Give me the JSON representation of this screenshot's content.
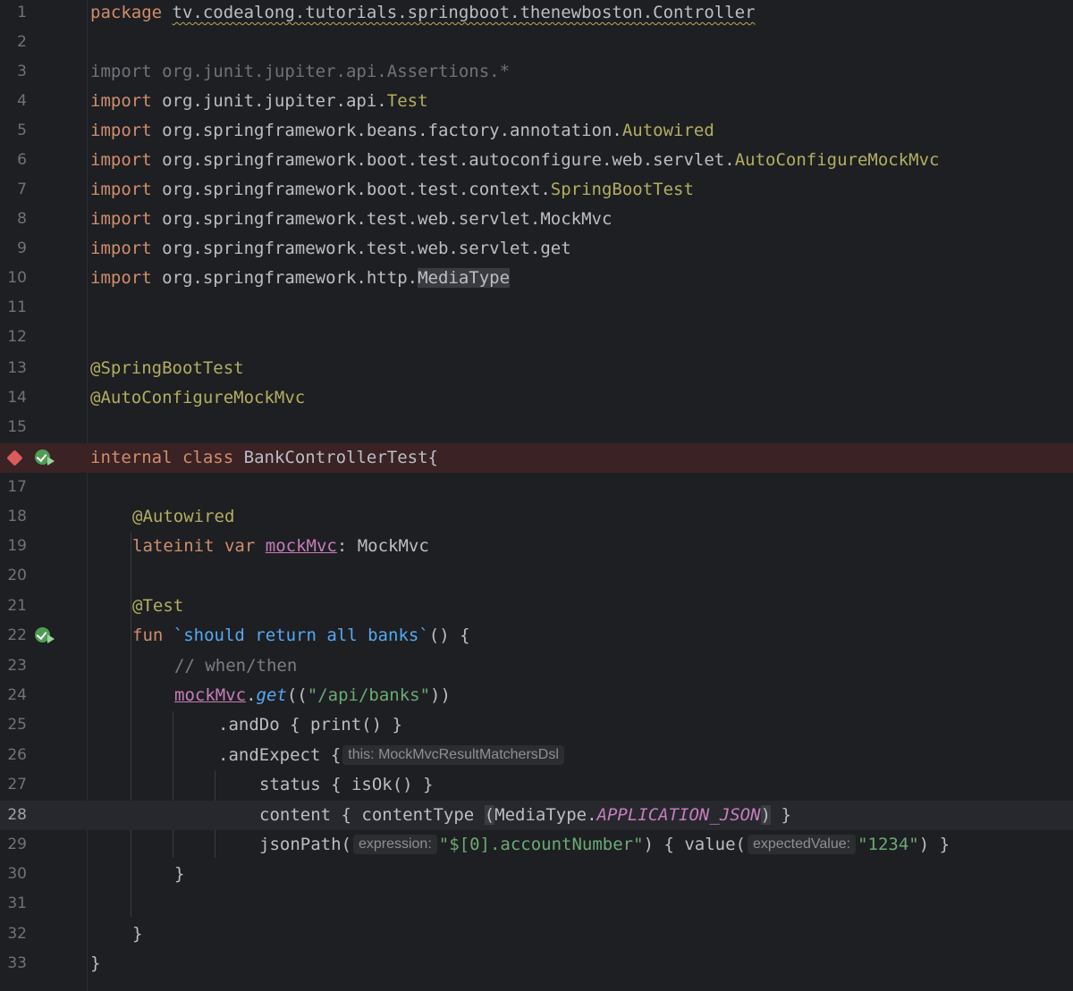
{
  "editor": {
    "language": "Kotlin",
    "caret_line": 28,
    "breakpoint_line": 16,
    "run_gutter_lines": [
      16,
      22
    ],
    "colors": {
      "background": "#1e1f22",
      "keyword": "#cf8e6d",
      "annotation": "#b3ae60",
      "string": "#6aab73",
      "function": "#56a8f5",
      "property": "#c77dbb",
      "breakpoint": "#db5c5c",
      "run_icon": "#4f9d54"
    },
    "line_numbers": [
      "1",
      "2",
      "3",
      "4",
      "5",
      "6",
      "7",
      "8",
      "9",
      "10",
      "11",
      "12",
      "13",
      "14",
      "15",
      "",
      "17",
      "18",
      "19",
      "20",
      "21",
      "22",
      "23",
      "24",
      "25",
      "26",
      "27",
      "28",
      "29",
      "30",
      "31",
      "32",
      "33"
    ],
    "tokens": {
      "package_kw": "package",
      "package_name": "tv.codealong.tutorials.springboot.thenewboston.Controller",
      "import_kw": "import",
      "imp3_path": "org.junit.jupiter.api.Assertions.*",
      "imp4_path": "org.junit.jupiter.api.",
      "imp4_cls": "Test",
      "imp5_path": "org.springframework.beans.factory.annotation.",
      "imp5_cls": "Autowired",
      "imp6_path": "org.springframework.boot.test.autoconfigure.web.servlet.",
      "imp6_cls": "AutoConfigureMockMvc",
      "imp7_path": "org.springframework.boot.test.context.",
      "imp7_cls": "SpringBootTest",
      "imp8_path": "org.springframework.test.web.servlet.MockMvc",
      "imp9_path": "org.springframework.test.web.servlet.get",
      "imp10_path": "org.springframework.http.",
      "imp10_cls": "MediaType",
      "ann_springboottest": "@SpringBootTest",
      "ann_autoconfigure": "@AutoConfigureMockMvc",
      "internal_kw": "internal",
      "class_kw": "class",
      "class_name": "BankControllerTest{",
      "ann_autowired": "@Autowired",
      "lateinit_kw": "lateinit",
      "var_kw": "var",
      "mockmvc_prop": "mockMvc",
      "mockmvc_type": ": MockMvc",
      "ann_test": "@Test",
      "fun_kw": "fun",
      "fun_name": "`should return all banks`",
      "fun_tail": "() {",
      "comment": "// when/then",
      "get_fn": "get",
      "open_paren": "((",
      "api_string": "\"/api/banks\"",
      "close_paren": "))",
      "dot": ".",
      "and_do": ".andDo { print() }",
      "and_expect": ".andExpect {",
      "hint_this": "this: MockMvcResultMatchersDsl",
      "status_line": "status { isOk() }",
      "content_start": "content { contentType ",
      "paren_open": "(",
      "media_type": "MediaType",
      "app_json": "APPLICATION_JSON",
      "paren_close": ")",
      "content_end": " }",
      "jsonpath_fn": "jsonPath(",
      "hint_expression": "expression:",
      "jsonpath_string": "\"$[0].accountNumber\"",
      "value_part": ") { value(",
      "hint_expected": "expectedValue:",
      "value_string": "\"1234\"",
      "value_end": ") }",
      "close_brace": "}"
    }
  }
}
